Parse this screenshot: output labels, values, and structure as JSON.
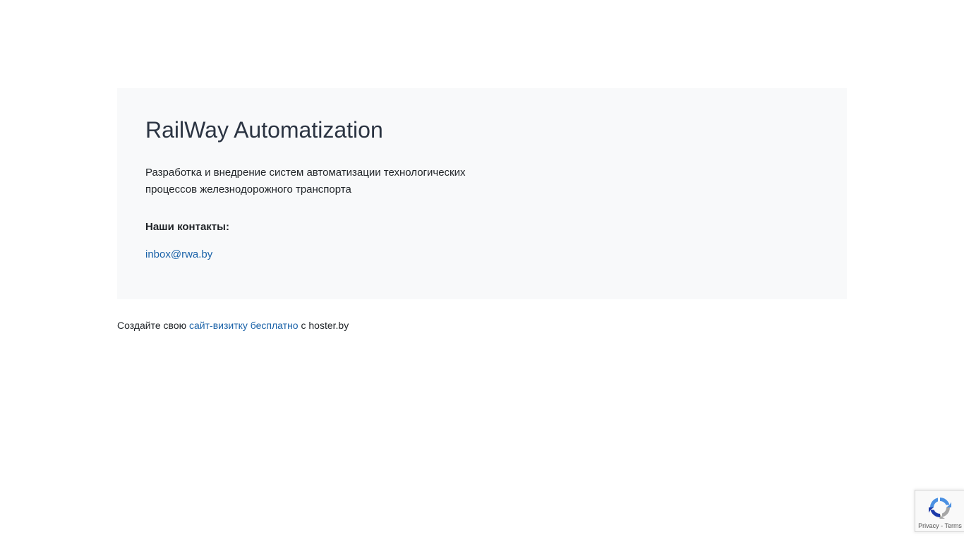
{
  "card": {
    "title": "RailWay Automatization",
    "description": "Разработка и внедрение систем автоматизации технологических процессов железнодорожного транспорта",
    "contacts_heading": "Наши контакты:",
    "email": "inbox@rwa.by"
  },
  "footer": {
    "prefix": "Создайте свою",
    "link_text": "сайт-визитку бесплатно",
    "suffix": "с hoster.by"
  },
  "recaptcha": {
    "icon": "recaptcha-logo-icon",
    "privacy": "Privacy",
    "separator": "-",
    "terms": "Terms"
  },
  "colors": {
    "card_background": "#f8f9fa",
    "title": "#2b3442",
    "link": "#1a62a8"
  }
}
